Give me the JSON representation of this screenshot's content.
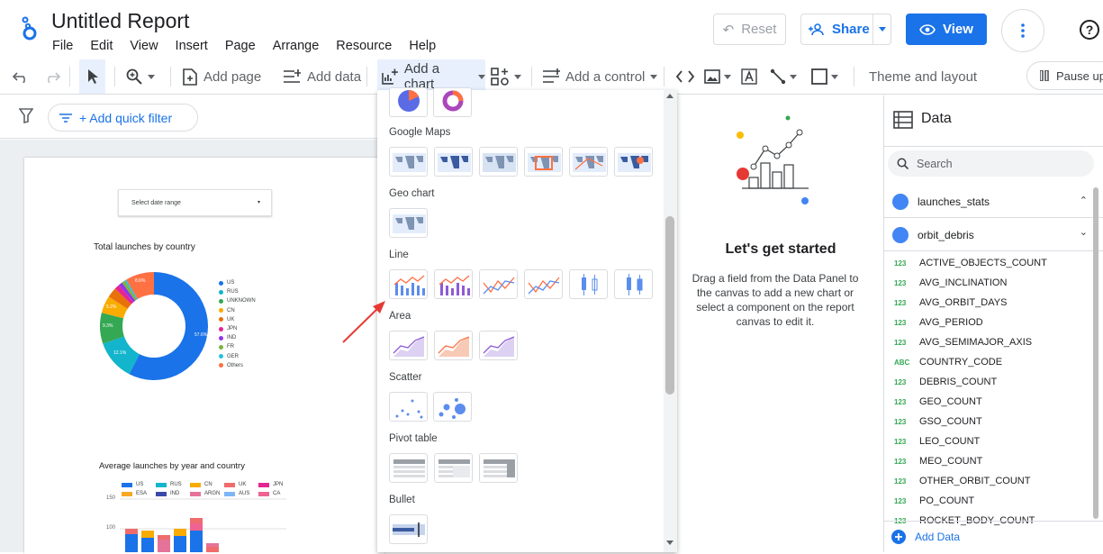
{
  "header": {
    "title": "Untitled Report",
    "menu": [
      "File",
      "Edit",
      "View",
      "Insert",
      "Page",
      "Arrange",
      "Resource",
      "Help"
    ],
    "reset_label": "Reset",
    "share_label": "Share",
    "view_label": "View"
  },
  "toolbar": {
    "add_page": "Add page",
    "add_data": "Add data",
    "add_chart": "Add a chart",
    "add_control": "Add a control",
    "theme": "Theme and layout",
    "pause": "Pause up"
  },
  "filterbar": {
    "quick_filter": "+ Add quick filter"
  },
  "report": {
    "date_range": "Select date range",
    "donut_title": "Total launches by country",
    "donut_legend": [
      "US",
      "RUS",
      "UNKNOWN",
      "CN",
      "UK",
      "JPN",
      "IND",
      "FR",
      "GER",
      "Others"
    ],
    "donut_colors": [
      "#1a73e8",
      "#12b5cb",
      "#34a853",
      "#f9ab00",
      "#e8710a",
      "#e52592",
      "#9334e6",
      "#7cb342",
      "#24c1e0",
      "#ff7043"
    ],
    "donut_labels": [
      "57.6%",
      "12.1%",
      "9.3%",
      "5.2%",
      "8.6%"
    ],
    "bar_title": "Average launches by year and country",
    "bar_legend": [
      "US",
      "RUS",
      "CN",
      "UK",
      "JPN",
      "ESA",
      "IND",
      "ARGN",
      "AUS",
      "CA"
    ],
    "bar_legend_colors": [
      "#1a73e8",
      "#12b5cb",
      "#f9ab00",
      "#ef6c6c",
      "#e52592",
      "#f9a825",
      "#3949ab",
      "#e57399",
      "#7cb6f5",
      "#f06292"
    ],
    "bar_ticks": [
      "150",
      "100"
    ]
  },
  "picker": {
    "categories": [
      "Google Maps",
      "Geo chart",
      "Line",
      "Area",
      "Scatter",
      "Pivot table",
      "Bullet"
    ]
  },
  "started": {
    "title": "Let's get started",
    "desc": "Drag a field from the Data Panel to the canvas to add a new chart or select a component on the report canvas to edit it."
  },
  "data_panel": {
    "title": "Data",
    "search_placeholder": "Search",
    "sources": [
      "launches_stats",
      "orbit_debris"
    ],
    "fields": [
      {
        "type": "123",
        "name": "ACTIVE_OBJECTS_COUNT"
      },
      {
        "type": "123",
        "name": "AVG_INCLINATION"
      },
      {
        "type": "123",
        "name": "AVG_ORBIT_DAYS"
      },
      {
        "type": "123",
        "name": "AVG_PERIOD"
      },
      {
        "type": "123",
        "name": "AVG_SEMIMAJOR_AXIS"
      },
      {
        "type": "ABC",
        "name": "COUNTRY_CODE"
      },
      {
        "type": "123",
        "name": "DEBRIS_COUNT"
      },
      {
        "type": "123",
        "name": "GEO_COUNT"
      },
      {
        "type": "123",
        "name": "GSO_COUNT"
      },
      {
        "type": "123",
        "name": "LEO_COUNT"
      },
      {
        "type": "123",
        "name": "MEO_COUNT"
      },
      {
        "type": "123",
        "name": "OTHER_ORBIT_COUNT"
      },
      {
        "type": "123",
        "name": "PO_COUNT"
      },
      {
        "type": "123",
        "name": "ROCKET_BODY_COUNT"
      }
    ],
    "add_data": "Add Data"
  }
}
